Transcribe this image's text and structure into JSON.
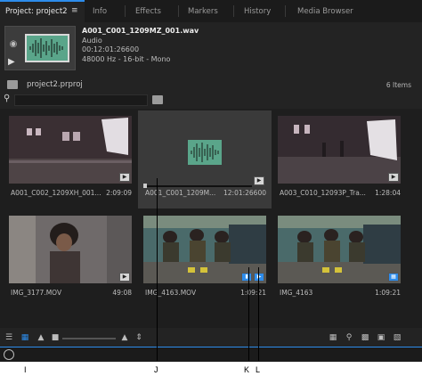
{
  "tabs": [
    {
      "label": "Project: project2",
      "active": true
    },
    {
      "label": "Info"
    },
    {
      "label": "Effects"
    },
    {
      "label": "Markers"
    },
    {
      "label": "History"
    },
    {
      "label": "Media Browser"
    }
  ],
  "tab_menu_icon": "hamburger-icon",
  "clip_info": {
    "name": "A001_C001_1209MZ_001.wav",
    "type": "Audio",
    "duration": "00:12:01:26600",
    "format": "48000 Hz - 16-bit - Mono"
  },
  "project": {
    "name": "project2.prproj",
    "item_count": "6 Items"
  },
  "clips": [
    {
      "name": "A001_C002_1209XH_001...",
      "duration": "2:09:09"
    },
    {
      "name": "A001_C001_1209M...",
      "duration": "12:01:26600",
      "selected": true
    },
    {
      "name": "A003_C010_12093P_Tra...",
      "duration": "1:28:04"
    },
    {
      "name": "IMG_3177.MOV",
      "duration": "49:08"
    },
    {
      "name": "IMG_4163.MOV",
      "duration": "1:09:21"
    },
    {
      "name": "IMG_4163",
      "duration": "1:09:21"
    }
  ],
  "callouts": [
    {
      "label": "I"
    },
    {
      "label": "J"
    },
    {
      "label": "K"
    },
    {
      "label": "L"
    }
  ],
  "colors": {
    "accent": "#2d8ceb",
    "audio_thumb": "#5aa58a"
  }
}
